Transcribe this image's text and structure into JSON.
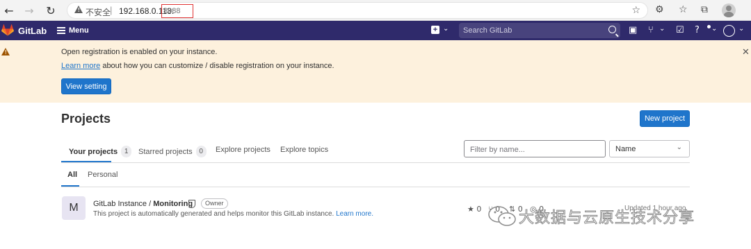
{
  "browser": {
    "security_label": "不安全",
    "url_host": "192.168.0.113:",
    "url_port": "8088"
  },
  "navbar": {
    "brand": "GitLab",
    "menu_label": "Menu",
    "search_placeholder": "Search GitLab",
    "brand_color": "#2f2a6b"
  },
  "alert": {
    "title": "Open registration is enabled on your instance.",
    "link_text": "Learn more",
    "body_text": " about how you can customize / disable registration on your instance.",
    "button_label": "View setting",
    "background_color": "#fdf1dd"
  },
  "main": {
    "title": "Projects",
    "new_project_label": "New project",
    "tabs": [
      {
        "label": "Your projects",
        "count": "1"
      },
      {
        "label": "Starred projects",
        "count": "0"
      },
      {
        "label": "Explore projects"
      },
      {
        "label": "Explore topics"
      }
    ],
    "filter_placeholder": "Filter by name...",
    "sort_label": "Name",
    "subtabs": [
      {
        "label": "All"
      },
      {
        "label": "Personal"
      }
    ]
  },
  "project": {
    "avatar_letter": "M",
    "namespace": "GitLab Instance / ",
    "name": "Monitoring",
    "role": "Owner",
    "description": "This project is automatically generated and helps monitor this GitLab instance. ",
    "learn_more": "Learn more.",
    "stars": "0",
    "forks": "0",
    "merge_requests": "0",
    "issues": "0",
    "updated": "Updated 1 hour ago"
  },
  "watermark": {
    "text": "大数据与云原生技术分享"
  },
  "accent_color": "#1f75cb"
}
